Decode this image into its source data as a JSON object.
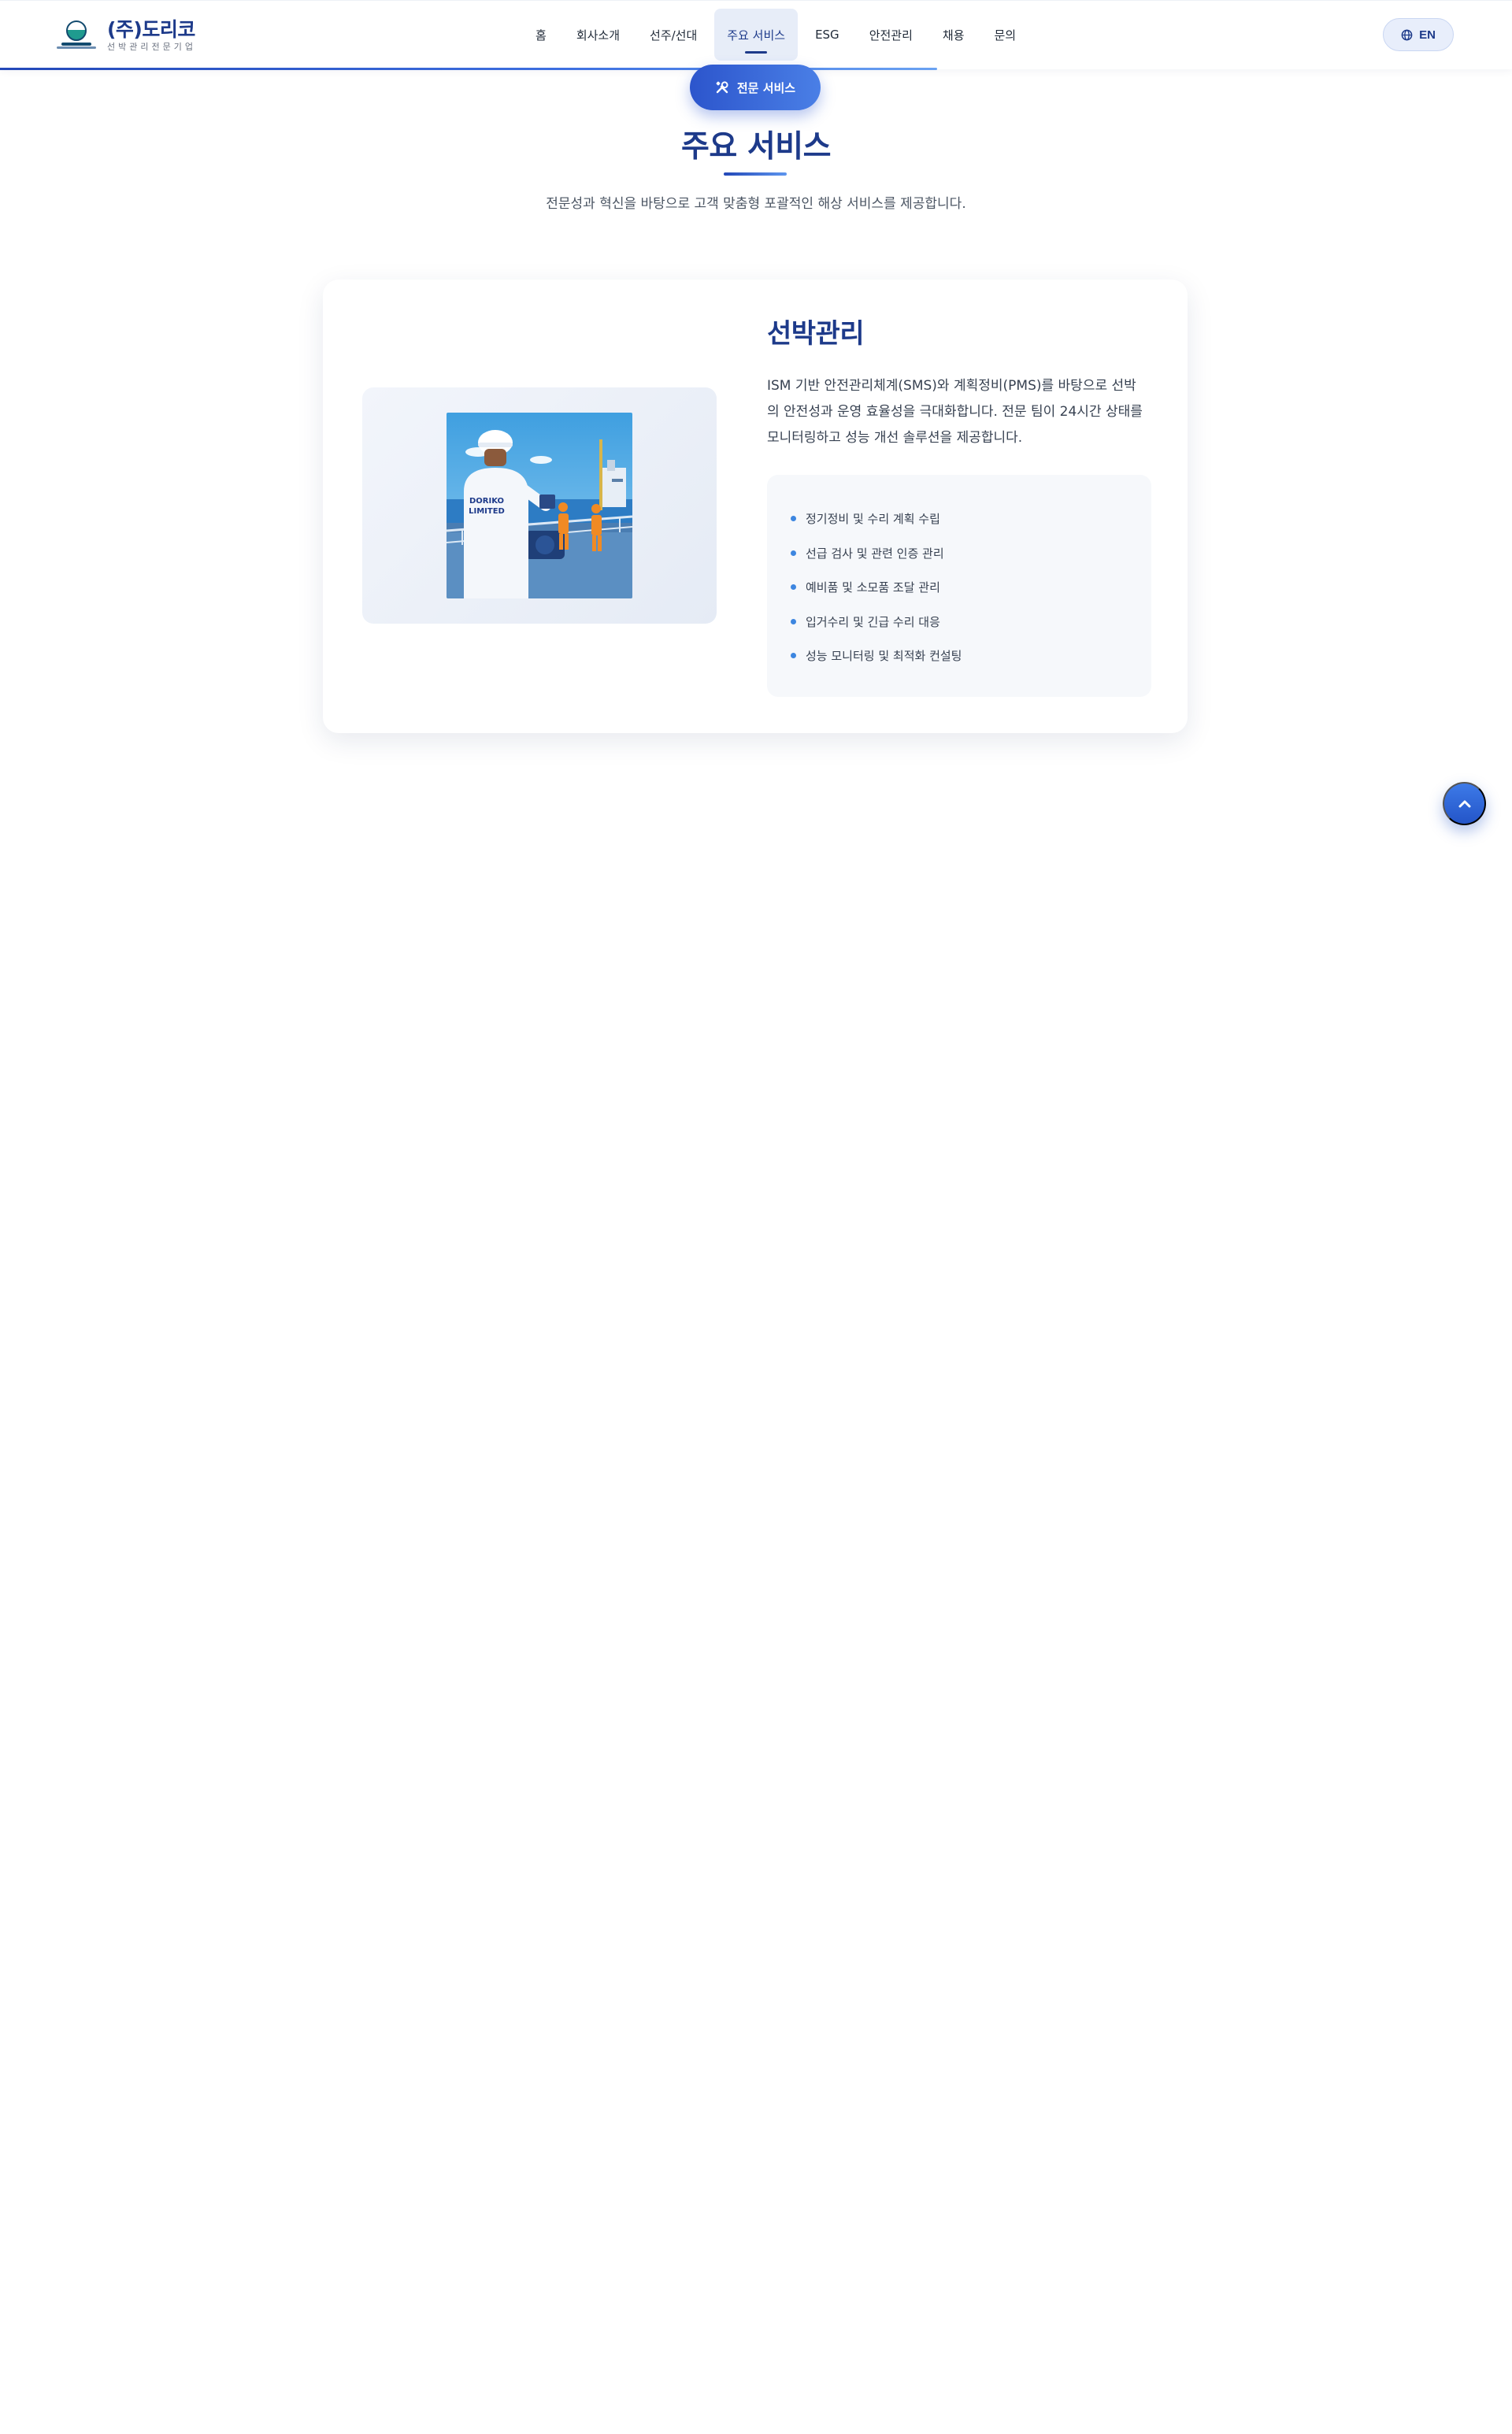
{
  "brand": {
    "name": "(주)도리코",
    "tagline": "선박관리전문기업",
    "logo_icon": "ship-emblem-icon"
  },
  "nav": {
    "items": [
      {
        "label": "홈"
      },
      {
        "label": "회사소개"
      },
      {
        "label": "선주/선대"
      },
      {
        "label": "주요 서비스"
      },
      {
        "label": "ESG"
      },
      {
        "label": "안전관리"
      },
      {
        "label": "채용"
      },
      {
        "label": "문의"
      }
    ],
    "active_index": 3,
    "language_button": "EN"
  },
  "section": {
    "badge": "전문 서비스",
    "badge_icon": "tools-icon",
    "title": "주요 서비스",
    "description": "전문성과 혁신을 바탕으로 고객 맞춤형 포괄적인 해상 서비스를 제공합니다."
  },
  "service_card": {
    "title": "선박관리",
    "description": "ISM 기반 안전관리체계(SMS)와 계획정비(PMS)를 바탕으로 선박의 안전성과 운영 효율성을 극대화합니다. 전문 팀이 24시간 상태를 모니터링하고 성능 개선 솔루션을 제공합니다.",
    "illustration_text": "DORIKO LIMITED",
    "features": [
      "정기정비 및 수리 계획 수립",
      "선급 검사 및 관련 인증 관리",
      "예비품 및 소모품 조달 관리",
      "입거수리 및 긴급 수리 대응",
      "성능 모니터링 및 최적화 컨설팅"
    ]
  },
  "scroll_progress": 0.62,
  "colors": {
    "primary": "#1d3a8a",
    "accent": "#3d7ae8",
    "muted": "#4b5563"
  }
}
